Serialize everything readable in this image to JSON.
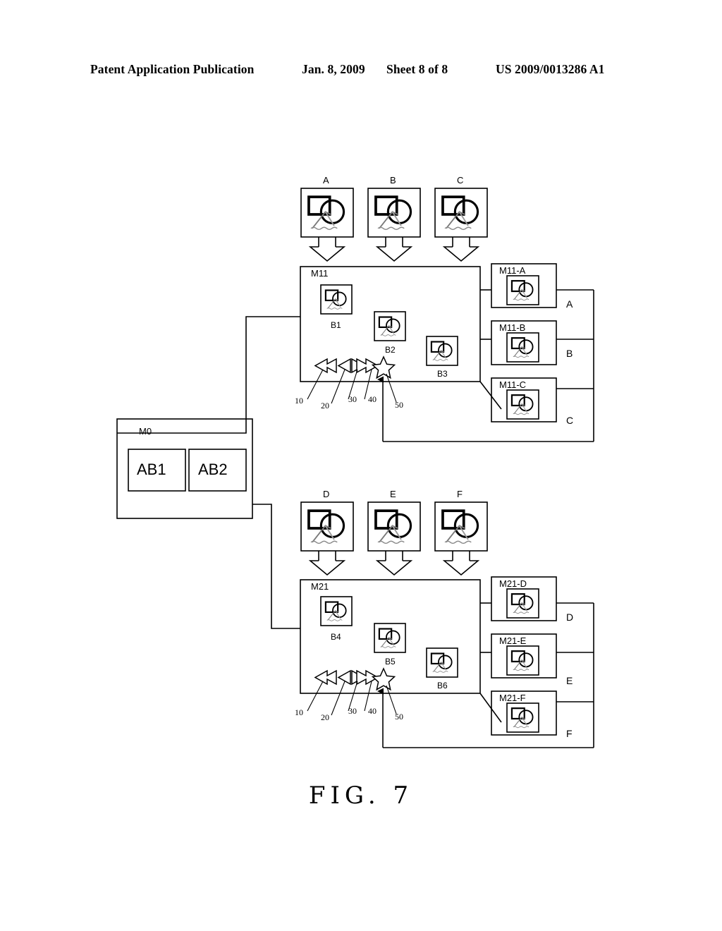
{
  "header": {
    "publication": "Patent Application Publication",
    "date": "Jan. 8, 2009",
    "sheet": "Sheet 8 of 8",
    "number": "US 2009/0013286 A1"
  },
  "figure": {
    "caption": "FIG.  7",
    "colors": {
      "line": "#000000",
      "fill": "#ffffff"
    },
    "source_images": {
      "top": [
        "A",
        "B",
        "C"
      ],
      "bottom": [
        "D",
        "E",
        "F"
      ]
    },
    "root_module": {
      "label": "M0",
      "children": [
        "AB1",
        "AB2"
      ]
    },
    "panels": [
      {
        "label": "M11",
        "thumbnails": [
          "B1",
          "B2",
          "B3"
        ],
        "controls": [
          {
            "name": "rewind",
            "ref": "10",
            "glyph": "double-left-arrow"
          },
          {
            "name": "previous",
            "ref": "20",
            "glyph": "left-arrow"
          },
          {
            "name": "next",
            "ref": "30",
            "glyph": "right-arrow"
          },
          {
            "name": "fast-forward",
            "ref": "40",
            "glyph": "double-right-arrow"
          },
          {
            "name": "favorite",
            "ref": "50",
            "glyph": "star"
          }
        ],
        "outputs": [
          "M11-A",
          "M11-B",
          "M11-C"
        ],
        "output_tags": [
          "A",
          "B",
          "C"
        ]
      },
      {
        "label": "M21",
        "thumbnails": [
          "B4",
          "B5",
          "B6"
        ],
        "controls": [
          {
            "name": "rewind",
            "ref": "10",
            "glyph": "double-left-arrow"
          },
          {
            "name": "previous",
            "ref": "20",
            "glyph": "left-arrow"
          },
          {
            "name": "next",
            "ref": "30",
            "glyph": "right-arrow"
          },
          {
            "name": "fast-forward",
            "ref": "40",
            "glyph": "double-right-arrow"
          },
          {
            "name": "favorite",
            "ref": "50",
            "glyph": "star"
          }
        ],
        "outputs": [
          "M21-D",
          "M21-E",
          "M21-F"
        ],
        "output_tags": [
          "D",
          "E",
          "F"
        ]
      }
    ]
  }
}
